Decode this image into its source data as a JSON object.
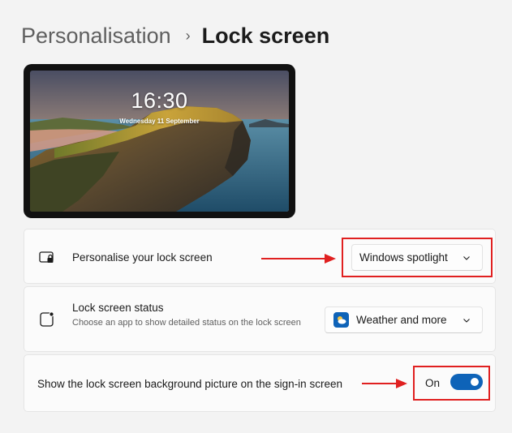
{
  "breadcrumb": {
    "parent": "Personalisation",
    "separator": "›",
    "current": "Lock screen"
  },
  "preview": {
    "time": "16:30",
    "date": "Wednesday 11 September"
  },
  "settings": [
    {
      "title": "Personalise your lock screen",
      "icon": "lock-screen-icon",
      "control": {
        "type": "dropdown",
        "value": "Windows spotlight",
        "icon": "chevron-down-icon"
      }
    },
    {
      "title": "Lock screen status",
      "description": "Choose an app to show detailed status on the lock screen",
      "icon": "tablet-status-icon",
      "control": {
        "type": "dropdown",
        "value": "Weather and more",
        "icon": "chevron-down-icon",
        "app_icon": "weather-icon"
      }
    },
    {
      "title": "Show the lock screen background picture on the sign-in screen",
      "control": {
        "type": "toggle",
        "label": "On",
        "state": true
      }
    }
  ],
  "colors": {
    "accent": "#0e63b8",
    "annotation": "#e02020",
    "background": "#f3f3f3",
    "card": "#fbfbfb"
  }
}
